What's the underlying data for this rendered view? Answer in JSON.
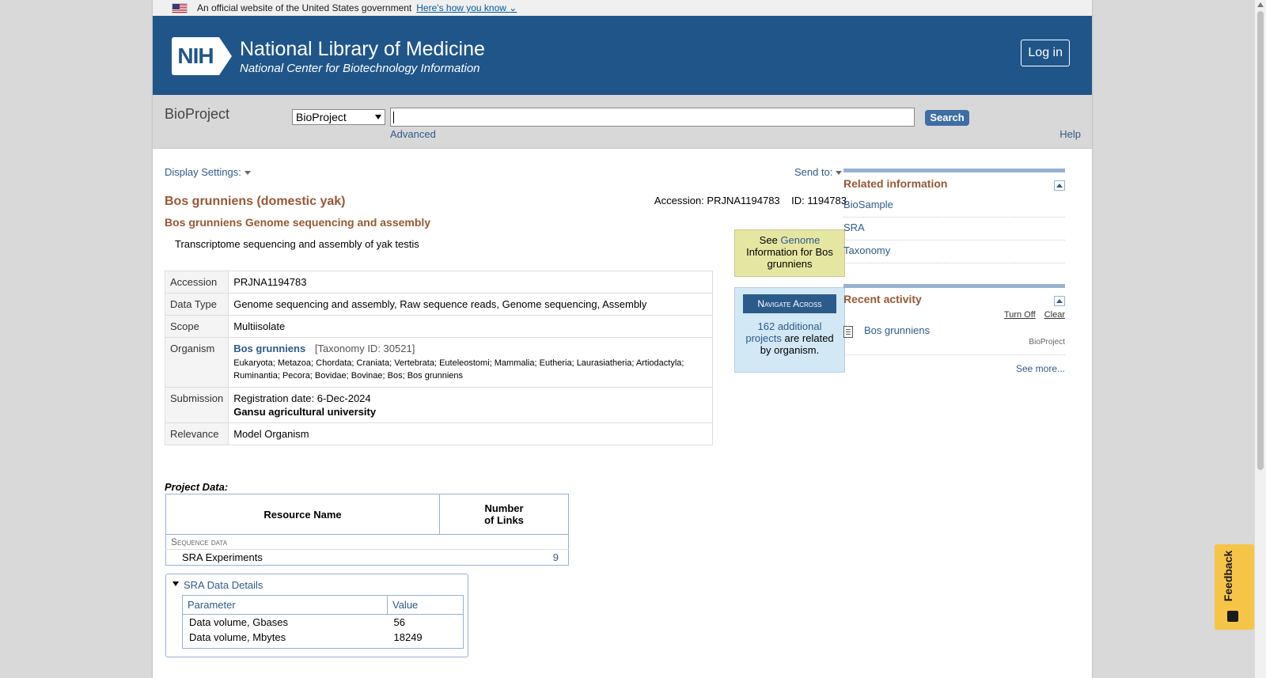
{
  "gov_banner": {
    "text": "An official website of the United States government",
    "link": "Here's how you know"
  },
  "header": {
    "logo_text": "NIH",
    "title": "National Library of Medicine",
    "subtitle": "National Center for Biotechnology Information",
    "login": "Log in"
  },
  "search": {
    "db_title": "BioProject",
    "db_selected": "BioProject",
    "query": "",
    "button": "Search",
    "advanced": "Advanced",
    "help": "Help"
  },
  "toolbar": {
    "display_settings": "Display Settings:",
    "send_to": "Send to:"
  },
  "record": {
    "title": "Bos grunniens (domestic yak)",
    "accession_line": "Accession: PRJNA1194783",
    "id_line": "ID: 1194783",
    "subtitle": "Bos grunniens Genome sequencing and assembly",
    "description": "Transcriptome sequencing and assembly of yak testis",
    "rows": {
      "accession": {
        "label": "Accession",
        "value": "PRJNA1194783"
      },
      "data_type": {
        "label": "Data Type",
        "value": "Genome sequencing and assembly, Raw sequence reads, Genome sequencing, Assembly"
      },
      "scope": {
        "label": "Scope",
        "value": "Multiisolate"
      },
      "organism": {
        "label": "Organism",
        "name": "Bos grunniens",
        "taxid": "[Taxonomy ID: 30521]",
        "lineage": "Eukaryota; Metazoa; Chordata; Craniata; Vertebrata; Euteleostomi; Mammalia; Eutheria; Laurasiatheria; Artiodactyla; Ruminantia; Pecora; Bovidae; Bovinae; Bos; Bos grunniens"
      },
      "submission": {
        "label": "Submission",
        "date": "Registration date: 6-Dec-2024",
        "org": "Gansu agricultural university"
      },
      "relevance": {
        "label": "Relevance",
        "value": "Model Organism"
      }
    }
  },
  "genome_box": {
    "see": "See",
    "link": "Genome",
    "rest": "Information for Bos grunniens"
  },
  "navigate": {
    "header": "Navigate Across",
    "link": "162 additional projects",
    "rest": "are related by organism."
  },
  "project_data": {
    "label": "Project Data:",
    "col_resource": "Resource Name",
    "col_links_1": "Number",
    "col_links_2": "of Links",
    "category": "Sequence data",
    "row_name": "SRA Experiments",
    "row_count": "9"
  },
  "sra_details": {
    "title": "SRA Data Details",
    "col_param": "Parameter",
    "col_value": "Value",
    "rows": [
      {
        "param": "Data volume, Gbases",
        "value": "56"
      },
      {
        "param": "Data volume, Mbytes",
        "value": "18249"
      }
    ]
  },
  "sidebar": {
    "related_title": "Related information",
    "related": [
      "BioSample",
      "SRA",
      "Taxonomy"
    ],
    "recent_title": "Recent activity",
    "turn_off": "Turn Off",
    "clear": "Clear",
    "recent_item": "Bos grunniens",
    "recent_db": "BioProject",
    "see_more": "See more..."
  },
  "feedback": "Feedback"
}
